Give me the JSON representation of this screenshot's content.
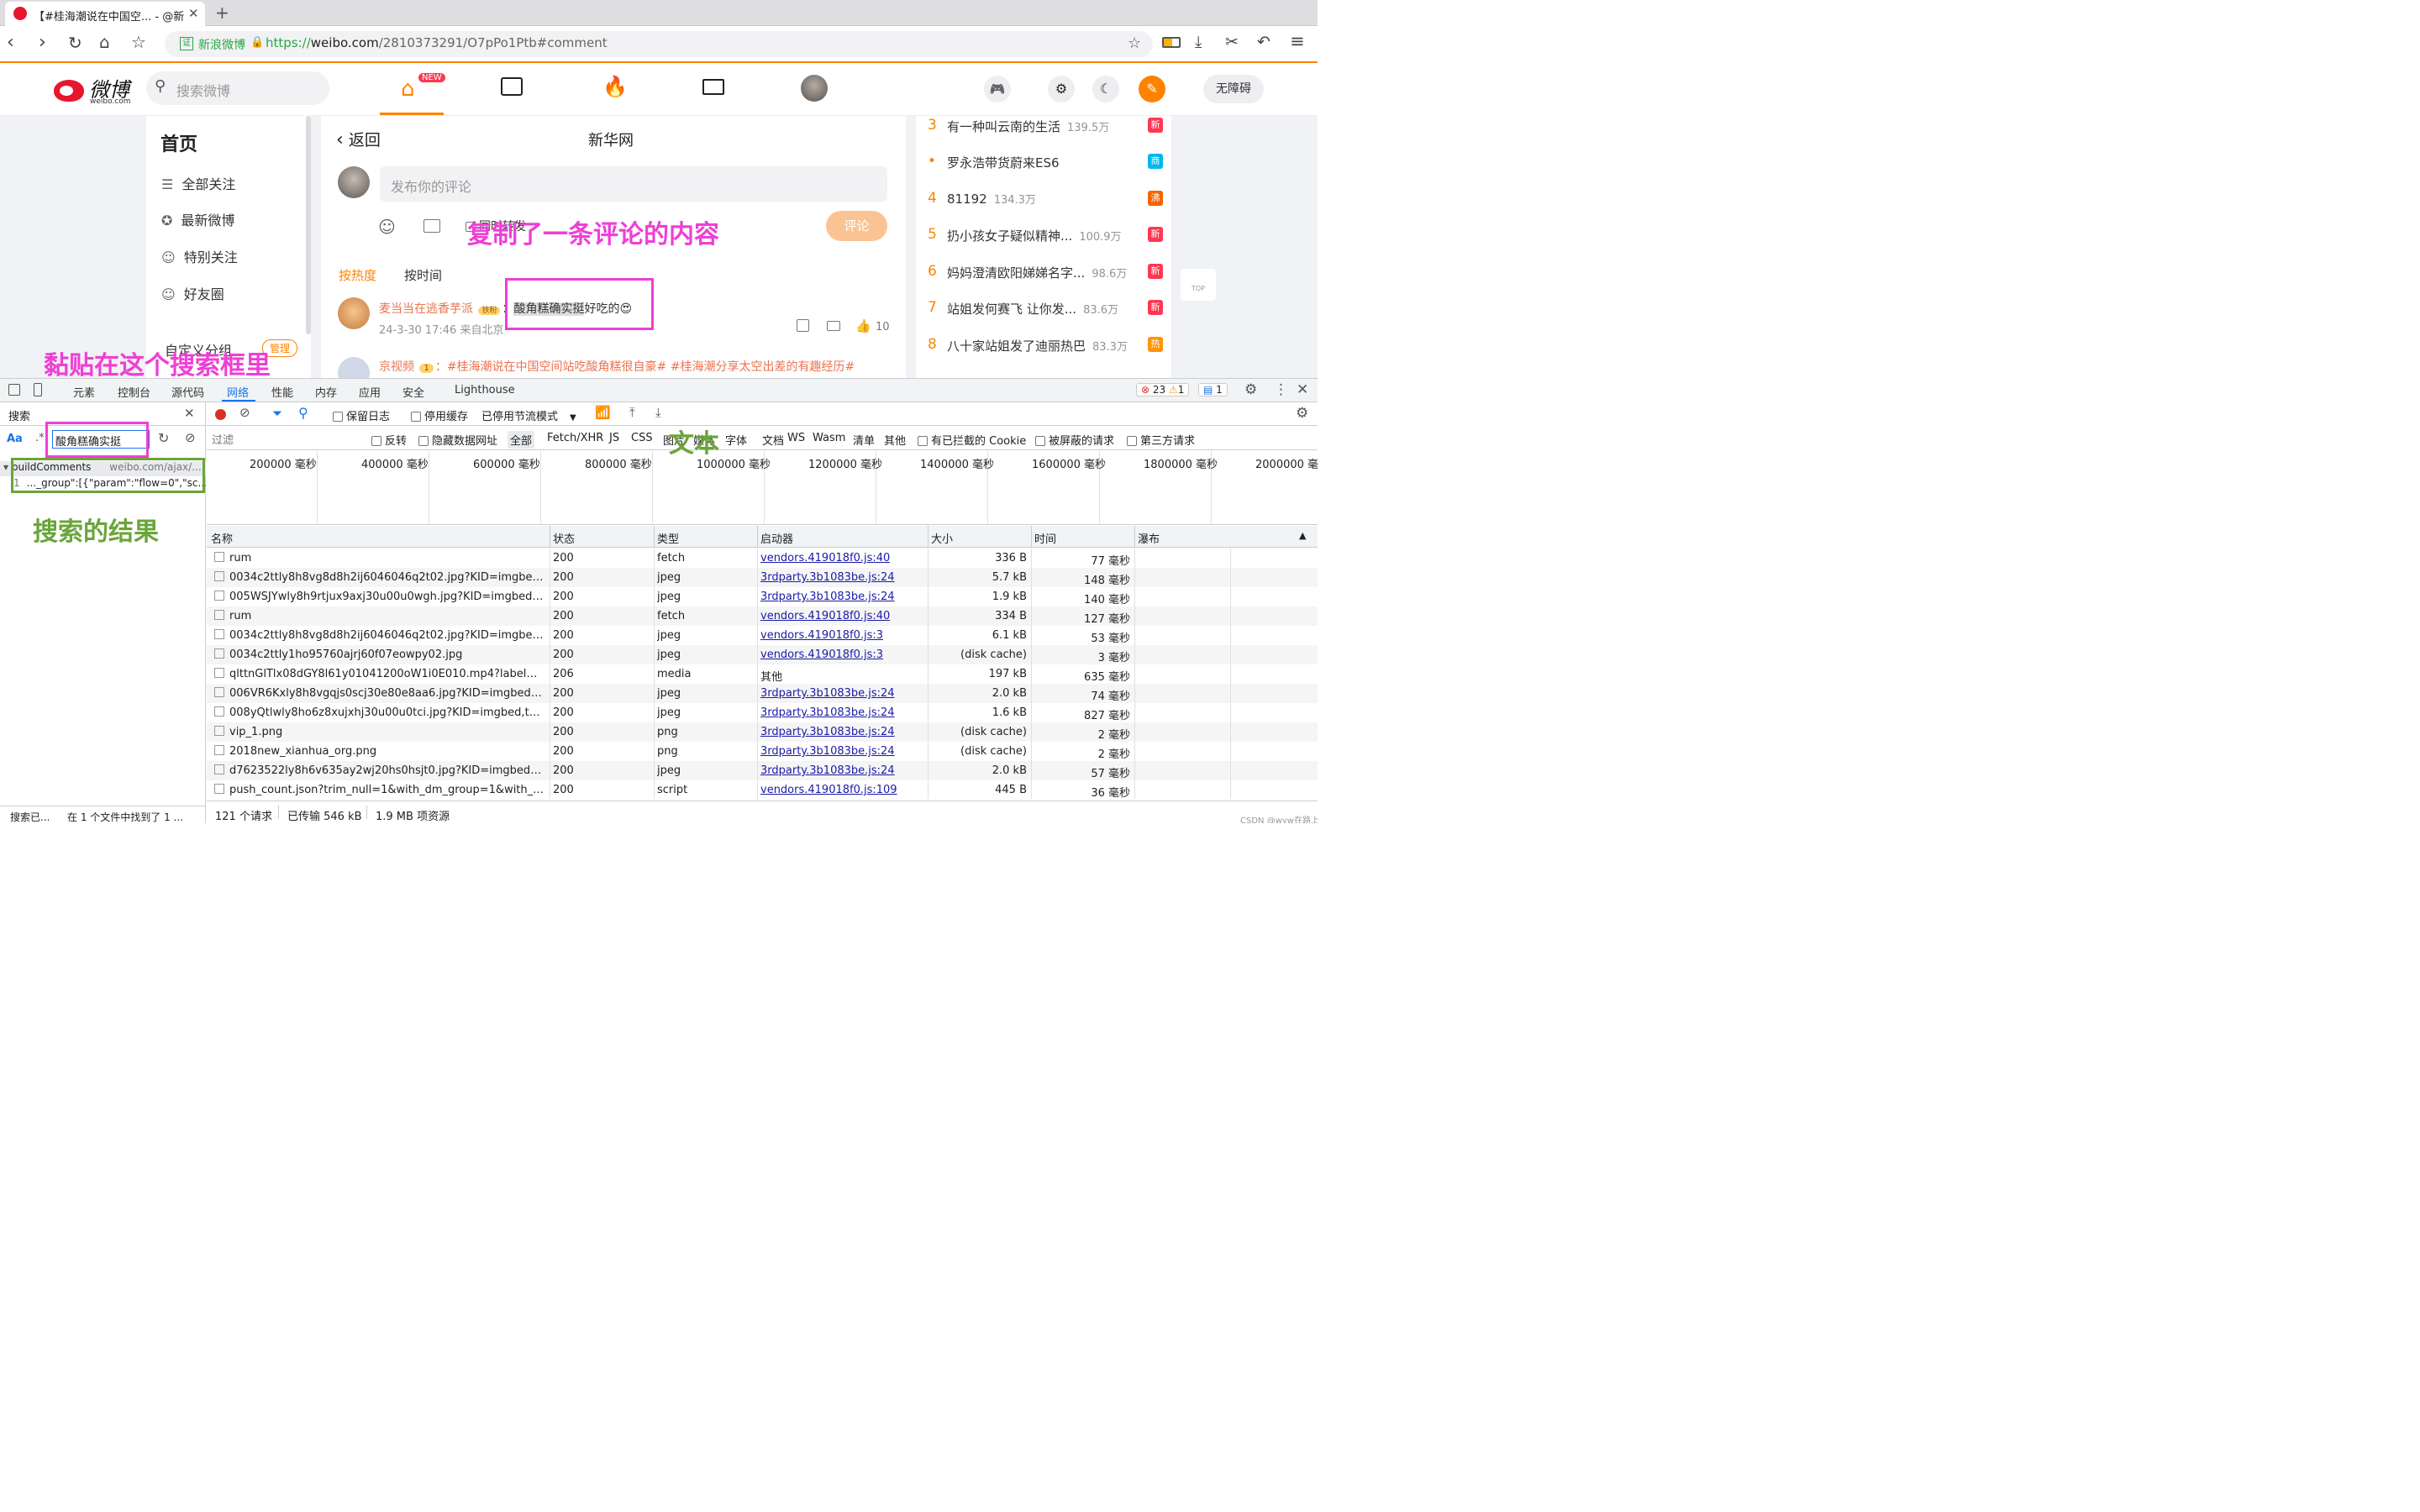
{
  "browser": {
    "tab_title": "【#桂海潮说在中国空... - @新",
    "url_site_label": "新浪微博",
    "url_scheme": "https://",
    "url_host": "weibo.com",
    "url_path": "/2810373291/O7pPo1Ptb#comment"
  },
  "weibo": {
    "logo_text": "微博",
    "logo_sub": "weibo.com",
    "search_placeholder": "搜索微博",
    "new_badge": "NEW",
    "accessibility": "无障碍",
    "left_nav": {
      "title": "首页",
      "items": [
        "全部关注",
        "最新微博",
        "特别关注",
        "好友圈"
      ],
      "custom_group": "自定义分组",
      "manage": "管理"
    },
    "detail": {
      "back": "返回",
      "author": "新华网",
      "comment_placeholder": "发布你的评论",
      "repost_option": "同时转发",
      "comment_btn": "评论",
      "sort_hot": "按热度",
      "sort_time": "按时间",
      "c1_user": "麦当当在逃香芋派",
      "c1_badge": "铁粉",
      "c1_colon": "：",
      "c1_text_hl": "酸角糕确实挺",
      "c1_text_rest": "好吃的😍",
      "c1_time": "24-3-30 17:46 来自北京",
      "c1_likes": "10",
      "c2_user": "京视频",
      "c2_badge": "1",
      "c2_text": "：#桂海潮说在中国空间站吃酸角糕很自豪# #桂海潮分享太空出差的有趣经历#"
    },
    "hot": [
      {
        "rank": "3",
        "title": "有一种叫云南的生活",
        "heat": "139.5万",
        "badge": "新",
        "color": "#ff3852"
      },
      {
        "rank": "•",
        "title": "罗永浩带货蔚来ES6",
        "heat": "",
        "badge": "商",
        "color": "#00b7ee"
      },
      {
        "rank": "4",
        "title": "81192",
        "heat": "134.3万",
        "badge": "沸",
        "color": "#f86400"
      },
      {
        "rank": "5",
        "title": "扔小孩女子疑似精神...",
        "heat": "100.9万",
        "badge": "新",
        "color": "#ff3852"
      },
      {
        "rank": "6",
        "title": "妈妈澄清欧阳娣娣名字...",
        "heat": "98.6万",
        "badge": "新",
        "color": "#ff3852"
      },
      {
        "rank": "7",
        "title": "站姐发何赛飞 让你发...",
        "heat": "83.6万",
        "badge": "新",
        "color": "#ff3852"
      },
      {
        "rank": "8",
        "title": "八十家站姐发了迪丽热巴",
        "heat": "83.3万",
        "badge": "热",
        "color": "#ff9406"
      }
    ],
    "top_label": "TOP"
  },
  "devtools": {
    "tabs": [
      "元素",
      "控制台",
      "源代码",
      "网络",
      "性能",
      "内存",
      "应用",
      "安全",
      "Lighthouse"
    ],
    "errors": "23",
    "warnings": "1",
    "messages": "1",
    "search_title": "搜索",
    "search_aa": "Aa",
    "search_regex": ".*",
    "search_value": "酸角糕确实挺",
    "result_file": "buildComments",
    "result_url": "weibo.com/ajax/...",
    "result_line_no": "1",
    "result_line": "..._group\":[{\"param\":\"flow=0\",\"sc...",
    "search_status_left": "搜索已...",
    "search_status_right": "在 1 个文件中找到了 1 ...",
    "toolbar": {
      "preserve_log": "保留日志",
      "disable_cache": "停用缓存",
      "throttle": "已停用节流模式"
    },
    "filter": {
      "placeholder": "过滤",
      "invert": "反转",
      "hide_data_urls": "隐藏数据网址",
      "types": [
        "全部",
        "Fetch/XHR",
        "JS",
        "CSS",
        "图片",
        "媒体",
        "字体",
        "文档",
        "WS",
        "Wasm",
        "清单",
        "其他"
      ],
      "blocked_cookies": "有已拦截的 Cookie",
      "blocked_requests": "被屏蔽的请求",
      "third_party": "第三方请求"
    },
    "timeline": [
      "200000 毫秒",
      "400000 毫秒",
      "600000 毫秒",
      "800000 毫秒",
      "1000000 毫秒",
      "1200000 毫秒",
      "1400000 毫秒",
      "1600000 毫秒",
      "1800000 毫秒",
      "2000000 毫秒"
    ],
    "columns": [
      "名称",
      "状态",
      "类型",
      "启动器",
      "大小",
      "时间",
      "瀑布"
    ],
    "rows": [
      {
        "name": "rum",
        "status": "200",
        "type": "fetch",
        "initiator": "vendors.419018f0.js:40",
        "size": "336 B",
        "time": "77 毫秒"
      },
      {
        "name": "0034c2ttly8h8vg8d8h2ij6046046q2t02.jpg?KID=imgbed,tva&E...",
        "status": "200",
        "type": "jpeg",
        "initiator": "3rdparty.3b1083be.js:24",
        "size": "5.7 kB",
        "time": "148 毫秒"
      },
      {
        "name": "005WSJYwly8h9rtjux9axj30u00u0wgh.jpg?KID=imgbed,tva&E...",
        "status": "200",
        "type": "jpeg",
        "initiator": "3rdparty.3b1083be.js:24",
        "size": "1.9 kB",
        "time": "140 毫秒"
      },
      {
        "name": "rum",
        "status": "200",
        "type": "fetch",
        "initiator": "vendors.419018f0.js:40",
        "size": "334 B",
        "time": "127 毫秒"
      },
      {
        "name": "0034c2ttly8h8vg8d8h2ij6046046q2t02.jpg?KID=imgbed,tva&E...",
        "status": "200",
        "type": "jpeg",
        "initiator": "vendors.419018f0.js:3",
        "size": "6.1 kB",
        "time": "53 毫秒"
      },
      {
        "name": "0034c2ttly1ho95760ajrj60f07eowpy02.jpg",
        "status": "200",
        "type": "jpeg",
        "initiator": "vendors.419018f0.js:3",
        "size": "(disk cache)",
        "time": "3 毫秒"
      },
      {
        "name": "qlttnGlTlx08dGY8l61y01041200oW1i0E010.mp4?label=mp......",
        "status": "206",
        "type": "media",
        "initiator": "其他",
        "size": "197 kB",
        "time": "635 毫秒"
      },
      {
        "name": "006VR6Kxly8h8vgqjs0scj30e80e8aa6.jpg?KID=imgbed,tva&E...",
        "status": "200",
        "type": "jpeg",
        "initiator": "3rdparty.3b1083be.js:24",
        "size": "2.0 kB",
        "time": "74 毫秒"
      },
      {
        "name": "008yQtlwly8ho6z8xujxhj30u00u0tci.jpg?KID=imgbed,tva&Expi...",
        "status": "200",
        "type": "jpeg",
        "initiator": "3rdparty.3b1083be.js:24",
        "size": "1.6 kB",
        "time": "827 毫秒"
      },
      {
        "name": "vip_1.png",
        "status": "200",
        "type": "png",
        "initiator": "3rdparty.3b1083be.js:24",
        "size": "(disk cache)",
        "time": "2 毫秒"
      },
      {
        "name": "2018new_xianhua_org.png",
        "status": "200",
        "type": "png",
        "initiator": "3rdparty.3b1083be.js:24",
        "size": "(disk cache)",
        "time": "2 毫秒"
      },
      {
        "name": "d7623522ly8h6v635ay2wj20hs0hsjt0.jpg?KID=imgbed,tva&Ex...",
        "status": "200",
        "type": "jpeg",
        "initiator": "3rdparty.3b1083be.js:24",
        "size": "2.0 kB",
        "time": "57 毫秒"
      },
      {
        "name": "push_count.json?trim_null=1&with_dm_group=1&with_r...ith_...",
        "status": "200",
        "type": "script",
        "initiator": "vendors.419018f0.js:109",
        "size": "445 B",
        "time": "36 毫秒"
      }
    ],
    "status": {
      "requests": "121 个请求",
      "transferred": "已传输 546 kB",
      "resources": "1.9 MB 项资源"
    }
  },
  "annotations": {
    "copied": "复制了一条评论的内容",
    "paste_here": "黏贴在这个搜索框里",
    "result": "搜索的结果",
    "text_label": "文本"
  },
  "watermark": "CSDN @wyw在路上"
}
